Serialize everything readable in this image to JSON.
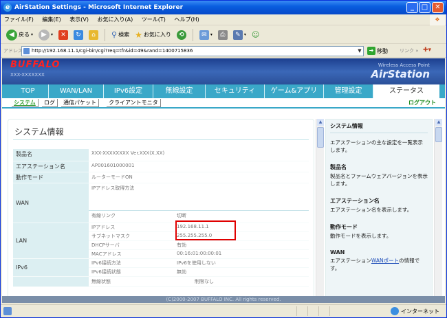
{
  "window": {
    "title": "AirStation Settings - Microsoft Internet Explorer",
    "minimize": "_",
    "maximize": "□",
    "close": "✕"
  },
  "menu": [
    "ファイル(F)",
    "編集(E)",
    "表示(V)",
    "お気に入り(A)",
    "ツール(T)",
    "ヘルプ(H)"
  ],
  "toolbar": {
    "back": "戻る",
    "search": "検索",
    "favorites": "お気に入り"
  },
  "address": {
    "label": "アドレス(D)",
    "url": "http://192.168.11.1/cgi-bin/cgi?req=tfr&id=49&rand=1400715836",
    "go": "移動",
    "links": "リンク »"
  },
  "header": {
    "logo": "BUFFALO",
    "model": "XXX-XXXXXXX",
    "tagline": "Wireless Access Point",
    "product": "AirStation"
  },
  "nav": [
    "TOP",
    "WAN/LAN",
    "IPv6設定",
    "無線設定",
    "セキュリティ",
    "ゲーム&アプリ",
    "管理設定",
    "ステータス"
  ],
  "subnav": [
    "システム",
    "ログ",
    "通信パケット",
    "クライアントモニタ"
  ],
  "logout": "ログアウト",
  "page": {
    "title": "システム情報",
    "rows": {
      "product_label": "製品名",
      "product_value": "XXX-XXXXXXXX Ver.XXX(X.XX)",
      "station_label": "エアステーション名",
      "station_value": "AP001601000001",
      "mode_label": "動作モード",
      "mode_value": "ルーターモードON",
      "wan_label": "WAN",
      "wan_method": "IPアドレス取得方法",
      "wan_link_key": "有線リンク",
      "wan_link_value": "切断",
      "lan_label": "LAN",
      "lan_ip_key": "IPアドレス",
      "lan_ip_value": "192.168.11.1",
      "lan_mask_key": "サブネットマスク",
      "lan_mask_value": "255.255.255.0",
      "lan_dhcp_key": "DHCPサーバ",
      "lan_dhcp_value": "有効",
      "lan_mac_key": "MACアドレス",
      "lan_mac_value": "00:16:01:00:00:01",
      "ipv6_label": "IPv6",
      "ipv6_method_key": "IPv6接続方法",
      "ipv6_method_value": "IPv6を使用しない",
      "ipv6_state_key": "IPv6接続状態",
      "ipv6_state_value": "無効",
      "wireless_key": "無線状態",
      "wireless_value": "制限なし"
    }
  },
  "footer": "(C)2000-2007 BUFFALO INC. All rights reserved.",
  "side": {
    "t1": "システム情報",
    "p1": "エアステーションの主な設定を一覧表示します。",
    "t2": "製品名",
    "p2": "製品名とファームウェアバージョンを表示します。",
    "t3": "エアステーション名",
    "p3": "エアステーション名を表示します。",
    "t4": "動作モード",
    "p4": "動作モードを表示します。",
    "t5": "WAN",
    "p5_pre": "エアステーション",
    "p5_link": "WANポート",
    "p5_post": "の情報で",
    "p5_cont": "す。"
  },
  "status": {
    "zone": "インターネット"
  }
}
